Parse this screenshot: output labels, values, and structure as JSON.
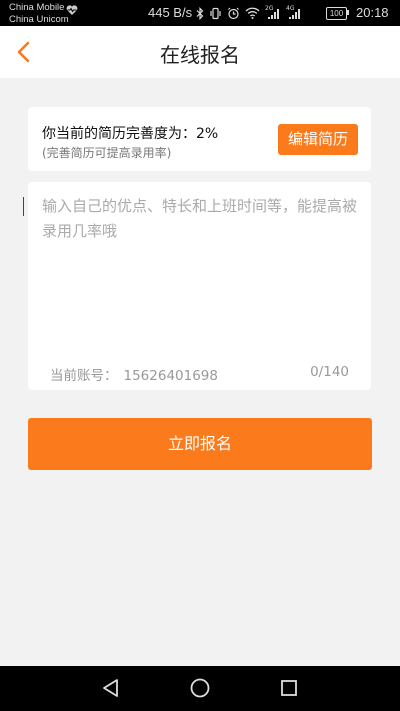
{
  "status_bar": {
    "carrier_1": "China Mobile",
    "carrier_2": "China Unicom",
    "speed": "445 B/s",
    "signal_labels": [
      "2G",
      "4G"
    ],
    "battery": "100",
    "time": "20:18"
  },
  "header": {
    "title": "在线报名",
    "back_icon": "chevron-left-icon"
  },
  "resume": {
    "completeness_label": "你当前的简历完善度为：",
    "completeness_value": "2%",
    "hint": "(完善简历可提高录用率)",
    "edit_button": "编辑简历"
  },
  "intro": {
    "placeholder": "输入自己的优点、特长和上班时间等，能提高被录用几率哦",
    "value": "",
    "account_label": "当前账号：",
    "account_value": "15626401698",
    "counter": "0/140"
  },
  "actions": {
    "submit": "立即报名"
  },
  "colors": {
    "accent": "#fb7a1c",
    "background": "#f2f2f2"
  }
}
